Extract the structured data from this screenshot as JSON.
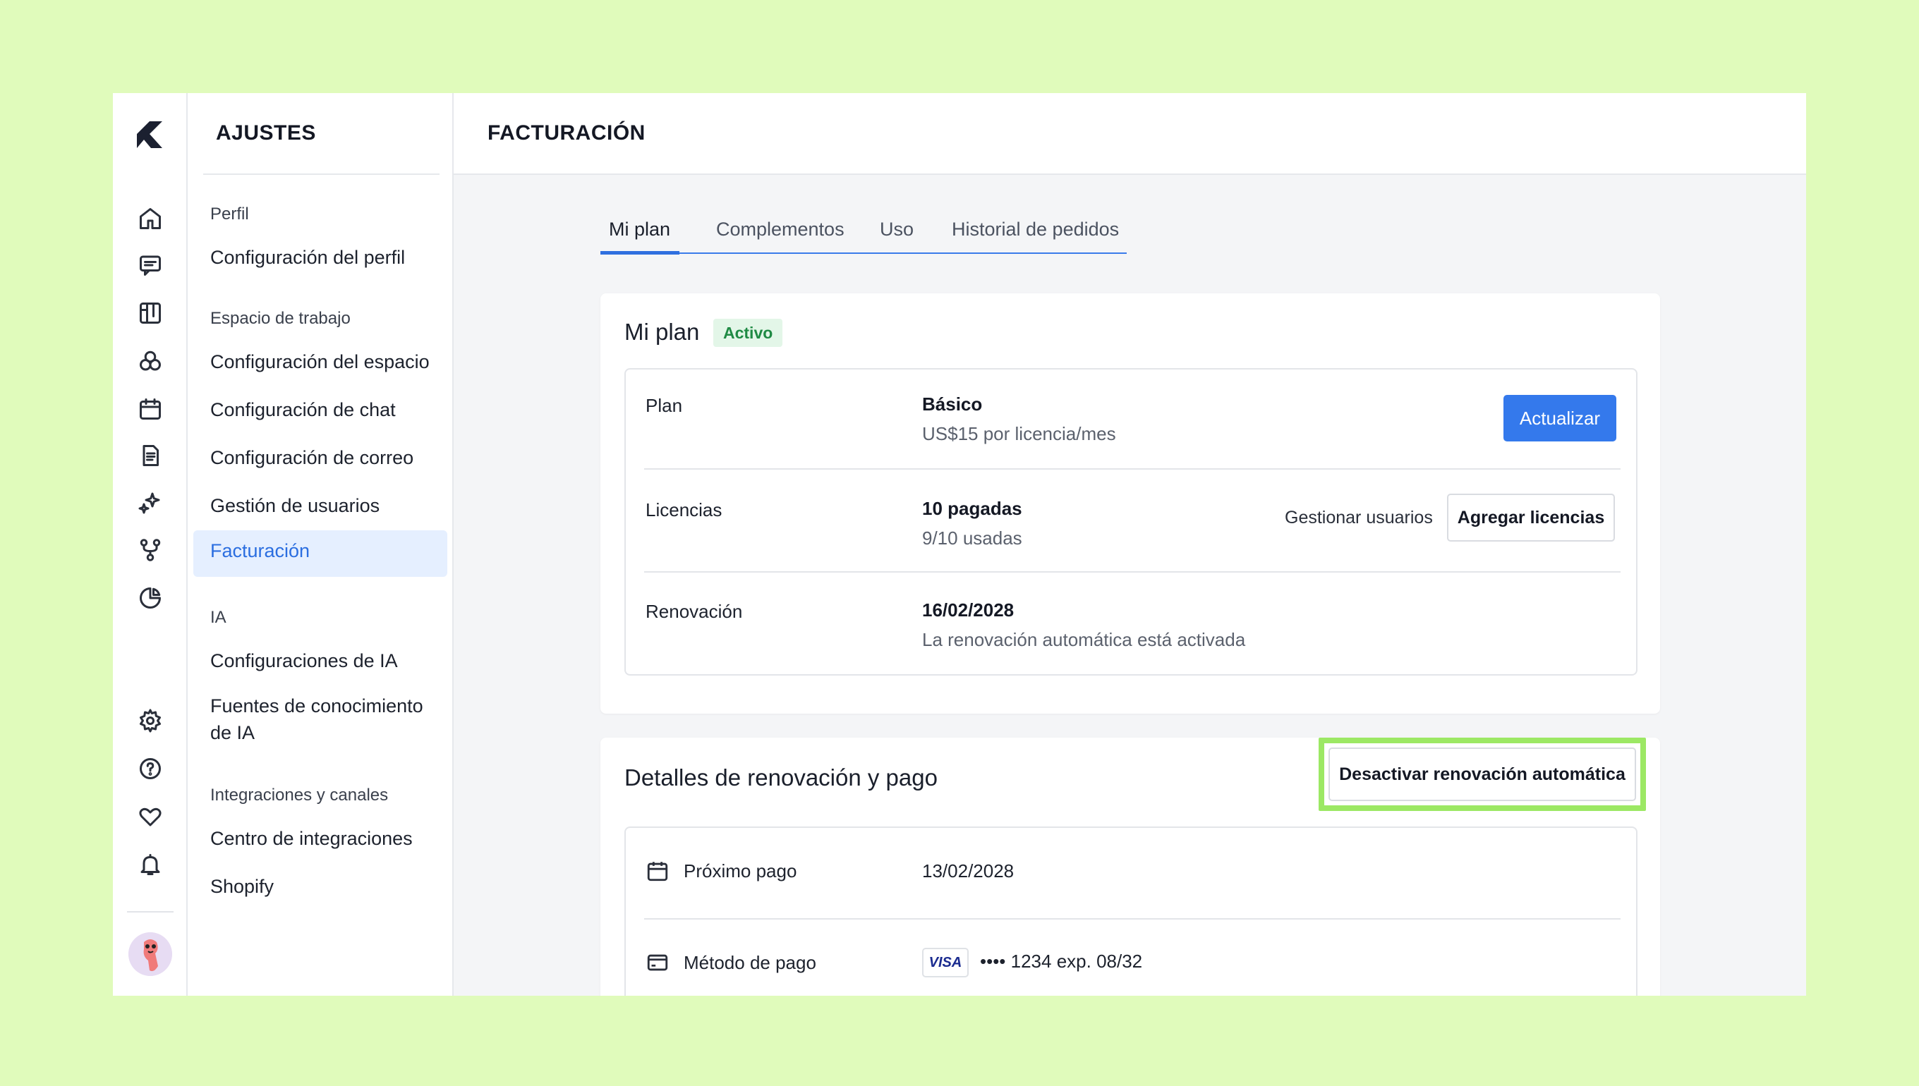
{
  "rail": {
    "icons": [
      "home-icon",
      "chat-icon",
      "board-icon",
      "circles-icon",
      "calendar-icon",
      "document-icon",
      "sparkle-icon",
      "branch-icon",
      "pie-chart-icon",
      "settings-icon",
      "help-icon",
      "heart-icon",
      "bell-icon"
    ]
  },
  "sidebar": {
    "title": "AJUSTES",
    "sections": {
      "perfil": "Perfil",
      "espacio": "Espacio de trabajo",
      "ia": "IA",
      "integraciones": "Integraciones y canales"
    },
    "items": {
      "config_perfil": "Configuración del perfil",
      "config_espacio": "Configuración del espacio",
      "config_chat": "Configuración de chat",
      "config_correo": "Configuración de correo",
      "gestion_usuarios": "Gestión de usuarios",
      "facturacion": "Facturación",
      "config_ia": "Configuraciones de IA",
      "fuentes_ia_line1": "Fuentes de conocimiento",
      "fuentes_ia_line2": "de IA",
      "centro_integraciones": "Centro de integraciones",
      "shopify": "Shopify"
    }
  },
  "header": {
    "title": "FACTURACIÓN"
  },
  "tabs": [
    "Mi plan",
    "Complementos",
    "Uso",
    "Historial de pedidos"
  ],
  "plan_card": {
    "title": "Mi plan",
    "badge": "Activo",
    "rows": {
      "plan": {
        "label": "Plan",
        "value": "Básico",
        "sub": "US$15 por licencia/mes",
        "button": "Actualizar"
      },
      "licencias": {
        "label": "Licencias",
        "value": "10 pagadas",
        "sub": "9/10 usadas",
        "link": "Gestionar usuarios",
        "button": "Agregar licencias"
      },
      "renovacion": {
        "label": "Renovación",
        "value": "16/02/2028",
        "sub": "La renovación automática está activada"
      }
    }
  },
  "payment_card": {
    "title": "Detalles de renovación y pago",
    "button": "Desactivar renovación automática",
    "rows": {
      "proximo": {
        "label": "Próximo pago",
        "value": "13/02/2028"
      },
      "metodo": {
        "label": "Método de pago",
        "brand": "VISA",
        "digits": "•••• 1234  exp. 08/32"
      }
    }
  },
  "colors": {
    "accent": "#3479ec",
    "highlight": "#9ce864",
    "background": "#e0fbbb",
    "badge": "#1f8a44"
  }
}
